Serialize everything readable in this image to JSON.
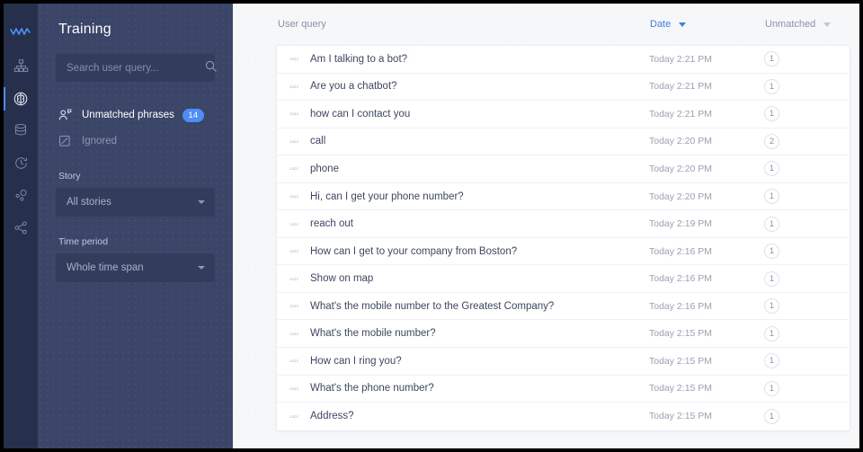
{
  "rail": {
    "logo_icon": "wave-logo-icon",
    "items": [
      {
        "icon": "sitemap-icon",
        "name": "rail-item-stories",
        "active": false
      },
      {
        "icon": "brain-icon",
        "name": "rail-item-training",
        "active": true
      },
      {
        "icon": "database-icon",
        "name": "rail-item-entities",
        "active": false
      },
      {
        "icon": "clock-history-icon",
        "name": "rail-item-history",
        "active": false
      },
      {
        "icon": "nodes-icon",
        "name": "rail-item-analytics",
        "active": false
      },
      {
        "icon": "share-icon",
        "name": "rail-item-integrations",
        "active": false
      }
    ]
  },
  "panel": {
    "title": "Training",
    "search": {
      "placeholder": "Search user query...",
      "value": "",
      "icon": "search-icon"
    },
    "nav": [
      {
        "label": "Unmatched phrases",
        "icon": "user-speech-icon",
        "badge": "14",
        "selected": true
      },
      {
        "label": "Ignored",
        "icon": "ignored-box-icon",
        "badge": "",
        "selected": false
      }
    ],
    "story": {
      "label": "Story",
      "value": "All stories"
    },
    "time_period": {
      "label": "Time period",
      "value": "Whole time span"
    }
  },
  "main": {
    "columns": {
      "query": "User query",
      "date": "Date",
      "unmatched": "Unmatched"
    },
    "sort_active_color": "#3f7fe0",
    "rows": [
      {
        "query": "Am I talking to a bot?",
        "date": "Today 2:21 PM",
        "count": "1"
      },
      {
        "query": "Are you a chatbot?",
        "date": "Today 2:21 PM",
        "count": "1"
      },
      {
        "query": "how can I contact you",
        "date": "Today 2:21 PM",
        "count": "1"
      },
      {
        "query": "call",
        "date": "Today 2:20 PM",
        "count": "2"
      },
      {
        "query": "phone",
        "date": "Today 2:20 PM",
        "count": "1"
      },
      {
        "query": "Hi, can I get your phone number?",
        "date": "Today 2:20 PM",
        "count": "1"
      },
      {
        "query": "reach out",
        "date": "Today 2:19 PM",
        "count": "1"
      },
      {
        "query": "How can I get to your company from Boston?",
        "date": "Today 2:16 PM",
        "count": "1"
      },
      {
        "query": "Show on map",
        "date": "Today 2:16 PM",
        "count": "1"
      },
      {
        "query": "What's the mobile number to the Greatest Company?",
        "date": "Today 2:16 PM",
        "count": "1"
      },
      {
        "query": "What's the mobile number?",
        "date": "Today 2:15 PM",
        "count": "1"
      },
      {
        "query": "How can I ring you?",
        "date": "Today 2:15 PM",
        "count": "1"
      },
      {
        "query": "What's the phone number?",
        "date": "Today 2:15 PM",
        "count": "1"
      },
      {
        "query": "Address?",
        "date": "Today 2:15 PM",
        "count": "1"
      }
    ]
  }
}
